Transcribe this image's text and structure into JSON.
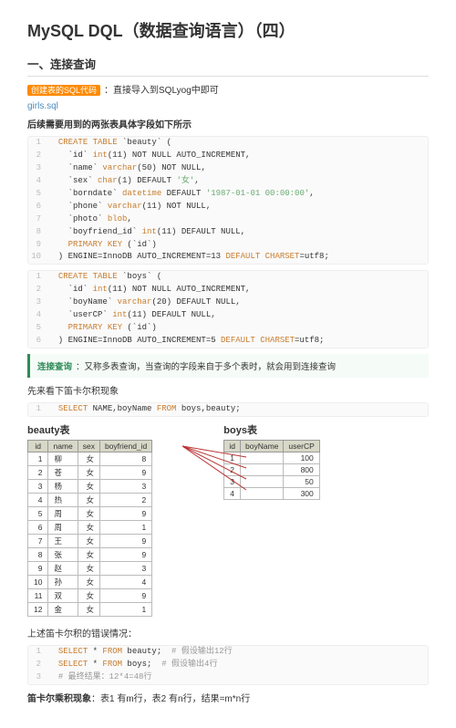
{
  "title": "MySQL DQL（数据查询语言）（四）",
  "section1_heading": "一、连接查询",
  "tag_text": "创建表的SQL代码",
  "tag_after": "：直接导入到SQLyog中即可",
  "sql_link": "girls.sql",
  "intro_bold": "后续需要用到的两张表具体字段如下所示",
  "code1": [
    {
      "n": "1",
      "pre": "  ",
      "k": "CREATE TABLE",
      "rest": " `beauty` ("
    },
    {
      "n": "2",
      "pre": "    `id` ",
      "k": "int",
      "rest": "(11) NOT NULL AUTO_INCREMENT,"
    },
    {
      "n": "3",
      "pre": "    `name` ",
      "k": "varchar",
      "rest": "(50) NOT NULL,"
    },
    {
      "n": "4",
      "pre": "    `sex` ",
      "k": "char",
      "rest": "(1) DEFAULT ",
      "s": "'女'",
      "tail": ","
    },
    {
      "n": "5",
      "pre": "    `borndate` ",
      "k": "datetime",
      "rest": " DEFAULT ",
      "s": "'1987-01-01 00:00:00'",
      "tail": ","
    },
    {
      "n": "6",
      "pre": "    `phone` ",
      "k": "varchar",
      "rest": "(11) NOT NULL,"
    },
    {
      "n": "7",
      "pre": "    `photo` ",
      "k": "blob",
      "rest": ","
    },
    {
      "n": "8",
      "pre": "    `boyfriend_id` ",
      "k": "int",
      "rest": "(11) DEFAULT NULL,"
    },
    {
      "n": "9",
      "pre": "    ",
      "k": "PRIMARY KEY",
      "rest": " (`id`)"
    },
    {
      "n": "10",
      "pre": "  ) ENGINE=InnoDB AUTO_INCREMENT=13 ",
      "k": "DEFAULT CHARSET",
      "rest": "=utf8;"
    }
  ],
  "code2": [
    {
      "n": "1",
      "pre": "  ",
      "k": "CREATE TABLE",
      "rest": " `boys` ("
    },
    {
      "n": "2",
      "pre": "    `id` ",
      "k": "int",
      "rest": "(11) NOT NULL AUTO_INCREMENT,"
    },
    {
      "n": "3",
      "pre": "    `boyName` ",
      "k": "varchar",
      "rest": "(20) DEFAULT NULL,"
    },
    {
      "n": "4",
      "pre": "    `userCP` ",
      "k": "int",
      "rest": "(11) DEFAULT NULL,"
    },
    {
      "n": "5",
      "pre": "    ",
      "k": "PRIMARY KEY",
      "rest": " (`id`)"
    },
    {
      "n": "6",
      "pre": "  ) ENGINE=InnoDB AUTO_INCREMENT=5 ",
      "k": "DEFAULT CHARSET",
      "rest": "=utf8;"
    }
  ],
  "callout_label": "连接查询",
  "callout_text": "：又称多表查询，当查询的字段来自于多个表时，就会用到连接查询",
  "para2": "先来看下笛卡尔积现象",
  "code3": [
    {
      "n": "1",
      "pre": "  ",
      "k": "SELECT",
      "rest": " NAME,boyName ",
      "k2": "FROM",
      "rest2": " boys,beauty;"
    }
  ],
  "beauty_label": "beauty表",
  "boys_label": "boys表",
  "beauty_headers": [
    "id",
    "name",
    "sex",
    "boyfriend_id"
  ],
  "beauty_rows": [
    {
      "id": "1",
      "name": "柳",
      "sex": "女",
      "bf": "8"
    },
    {
      "id": "2",
      "name": "苍",
      "sex": "女",
      "bf": "9"
    },
    {
      "id": "3",
      "name": "杨",
      "sex": "女",
      "bf": "3"
    },
    {
      "id": "4",
      "name": "热",
      "sex": "女",
      "bf": "2"
    },
    {
      "id": "5",
      "name": "周",
      "sex": "女",
      "bf": "9"
    },
    {
      "id": "6",
      "name": "周",
      "sex": "女",
      "bf": "1"
    },
    {
      "id": "7",
      "name": "王",
      "sex": "女",
      "bf": "9"
    },
    {
      "id": "8",
      "name": "张",
      "sex": "女",
      "bf": "9"
    },
    {
      "id": "9",
      "name": "赵",
      "sex": "女",
      "bf": "3"
    },
    {
      "id": "10",
      "name": "孙",
      "sex": "女",
      "bf": "4"
    },
    {
      "id": "11",
      "name": "双",
      "sex": "女",
      "bf": "9"
    },
    {
      "id": "12",
      "name": "金",
      "sex": "女",
      "bf": "1"
    }
  ],
  "boys_headers": [
    "id",
    "boyName",
    "userCP"
  ],
  "boys_rows": [
    {
      "id": "1",
      "name": "",
      "cp": "100"
    },
    {
      "id": "2",
      "name": "",
      "cp": "800"
    },
    {
      "id": "3",
      "name": "",
      "cp": "50"
    },
    {
      "id": "4",
      "name": "",
      "cp": "300"
    }
  ],
  "para3": "上述笛卡尔积的错误情况：",
  "code4": [
    {
      "n": "1",
      "pre": "  ",
      "k": "SELECT",
      "rest": " * ",
      "k2": "FROM",
      "rest2": " beauty;  ",
      "c": "# 假设输出12行"
    },
    {
      "n": "2",
      "pre": "  ",
      "k": "SELECT",
      "rest": " * ",
      "k2": "FROM",
      "rest2": " boys;  ",
      "c": "# 假设输出4行"
    },
    {
      "n": "3",
      "pre": "  ",
      "c": "# 最终结果：12*4=48行"
    }
  ],
  "final_line_label": "笛卡尔乘积现象",
  "final_line_text": "：表1 有m行，表2 有n行，结果=m*n行"
}
